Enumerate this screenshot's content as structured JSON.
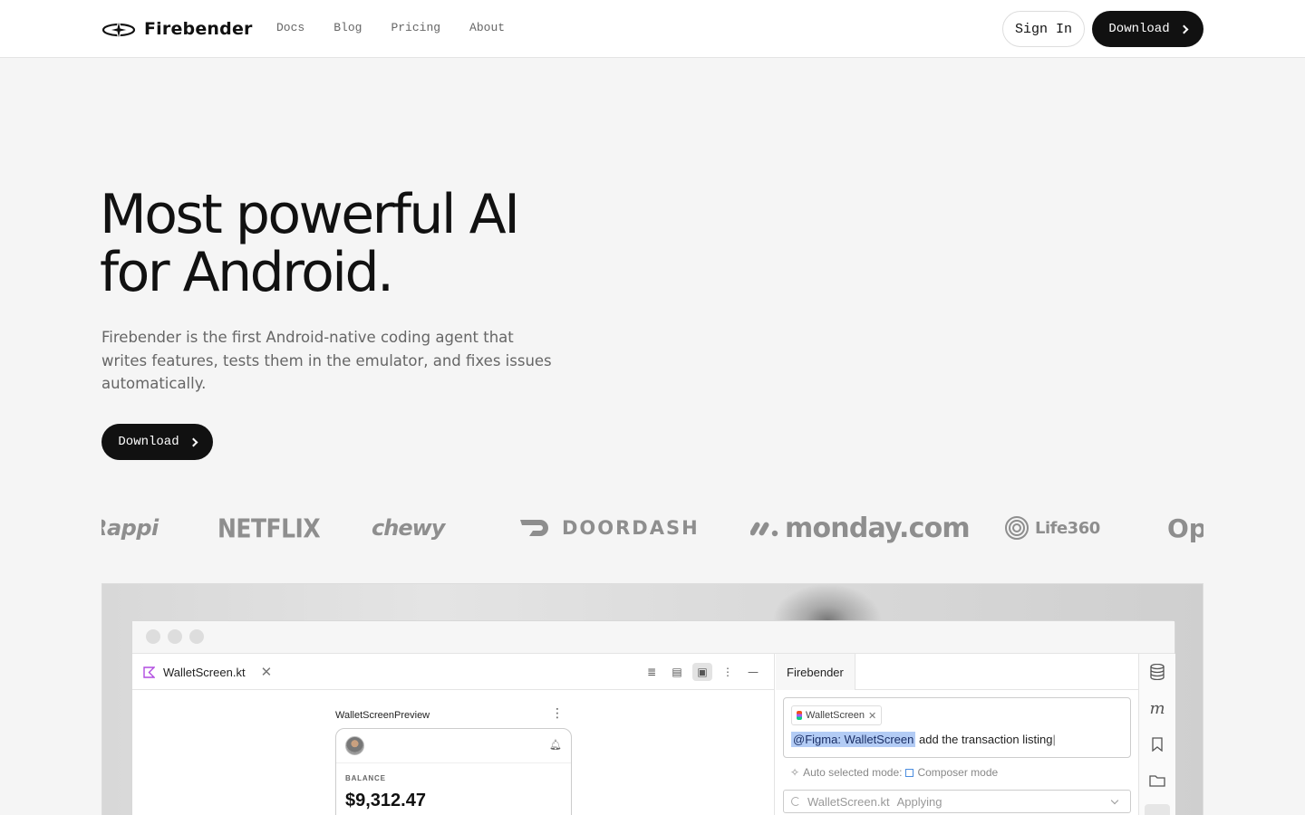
{
  "nav": {
    "brand": "Firebender",
    "links": [
      "Docs",
      "Blog",
      "Pricing",
      "About"
    ],
    "signin_label": "Sign In",
    "download_label": "Download"
  },
  "hero": {
    "title_line1": "Most powerful AI",
    "title_line2": "for Android.",
    "subtitle": "Firebender is the first Android-native coding agent that writes features, tests them in the emulator, and fixes issues automatically.",
    "download_label": "Download"
  },
  "customer_logos": [
    "Rappi",
    "NETFLIX",
    "chewy",
    "DOORDASH",
    "monday.com",
    "Life360",
    "Op"
  ],
  "ide": {
    "file_tab": "WalletScreen.kt",
    "preview_label": "WalletScreenPreview",
    "balance_label": "BALANCE",
    "balance_value": "$9,312.47",
    "chat_tab": "Firebender",
    "context_chip": "WalletScreen",
    "mention": "@Figma: WalletScreen",
    "prompt_text": "add the transaction listing",
    "mode_prefix": "Auto selected mode:",
    "mode_name": "Composer mode",
    "status_file": "WalletScreen.kt",
    "status_text": "Applying"
  },
  "colors": {
    "primary": "#111111",
    "muted_text": "#666666",
    "page_bg": "#f5f5f5",
    "mention_bg": "#b3ccf5"
  }
}
